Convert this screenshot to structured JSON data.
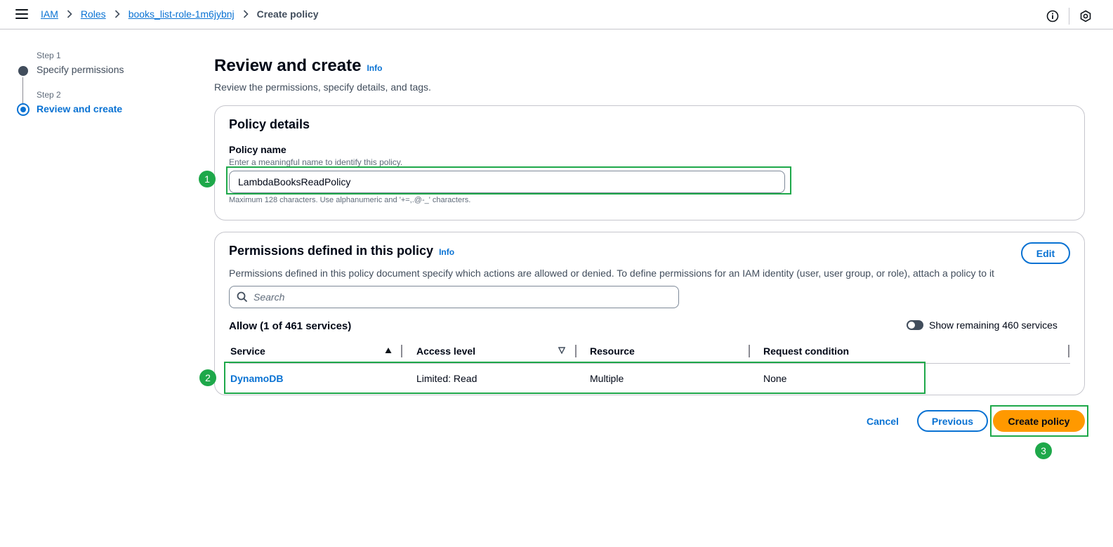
{
  "breadcrumb": {
    "items": [
      "IAM",
      "Roles",
      "books_list-role-1m6jybnj"
    ],
    "current": "Create policy"
  },
  "steps": [
    {
      "label": "Step 1",
      "title": "Specify permissions"
    },
    {
      "label": "Step 2",
      "title": "Review and create"
    }
  ],
  "header": {
    "title": "Review and create",
    "info": "Info",
    "description": "Review the permissions, specify details, and tags."
  },
  "policy_details": {
    "title": "Policy details",
    "name_label": "Policy name",
    "name_description": "Enter a meaningful name to identify this policy.",
    "name_value": "LambdaBooksReadPolicy",
    "name_constraint": "Maximum 128 characters. Use alphanumeric and '+=,.@-_' characters."
  },
  "permissions": {
    "title": "Permissions defined in this policy",
    "info": "Info",
    "edit": "Edit",
    "description": "Permissions defined in this policy document specify which actions are allowed or denied. To define permissions for an IAM identity (user, user group, or role), attach a policy to it",
    "search_placeholder": "Search",
    "allow_heading": "Allow (1 of 461 services)",
    "toggle_label": "Show remaining 460 services",
    "columns": [
      "Service",
      "Access level",
      "Resource",
      "Request condition"
    ],
    "rows": [
      {
        "service": "DynamoDB",
        "access_level": "Limited: Read",
        "resource": "Multiple",
        "condition": "None"
      }
    ]
  },
  "actions": {
    "cancel": "Cancel",
    "previous": "Previous",
    "create": "Create policy"
  },
  "annotations": [
    "1",
    "2",
    "3"
  ],
  "colors": {
    "link": "#0972d3",
    "primary": "#ff9900",
    "highlight": "#1ea84a"
  }
}
